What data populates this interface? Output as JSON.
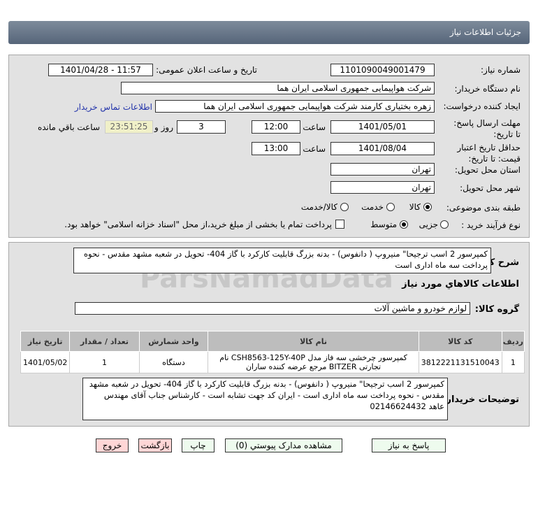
{
  "header": {
    "title": "جزئیات اطلاعات نیاز"
  },
  "watermark": "ParsNamadData",
  "form": {
    "need_number_label": "شماره نیاز:",
    "need_number": "1101090049001479",
    "announce_label": "تاریخ و ساعت اعلان عمومی:",
    "announce_value": "1401/04/28 - 11:57",
    "buyer_label": "نام دستگاه خریدار:",
    "buyer_value": "شرکت هواپیمایی جمهوری اسلامی ایران هما",
    "creator_label": "ایجاد کننده درخواست:",
    "creator_value": "زهره بختیاری کارمند شرکت هواپیمایی جمهوری اسلامی ایران هما",
    "contact_link": "اطلاعات تماس خریدار",
    "deadline_label": "مهلت ارسال پاسخ: تا تاریخ:",
    "deadline_date": "1401/05/01",
    "time_label": "ساعت",
    "deadline_time": "12:00",
    "days": "3",
    "days_label": "روز و",
    "remaining": "23:51:25",
    "remaining_label": "ساعت باقي مانده",
    "validity_label": "حداقل تاریخ اعتبار قیمت: تا تاریخ:",
    "validity_date": "1401/08/04",
    "validity_time": "13:00",
    "province_label": "استان محل تحویل:",
    "province": "تهران",
    "city_label": "شهر محل تحویل:",
    "city": "تهران",
    "category_label": "طبقه بندی موضوعی:",
    "category_options": [
      "كالا",
      "خدمت",
      "كالا/خدمت"
    ],
    "category_selected": "كالا",
    "process_label": "نوع فرآیند خرید :",
    "process_options": [
      "جزیی",
      "متوسط"
    ],
    "process_selected": "متوسط",
    "payment_checkbox": "پرداخت تمام یا بخشی از مبلغ خرید،از محل \"اسناد خزانه اسلامی\" خواهد بود.",
    "payment_checked": false
  },
  "details": {
    "summary_label": "شرح کلي نياز:",
    "summary": "کمپرسور  2  اسب ترجیحا\" منیروپ ( دانفوس) - بدنه بزرگ قابلیت کارکرد با گاز 404- تحویل در شعبه مشهد مقدس - نحوه پرداخت سه ماه اداری است",
    "goods_title": "اطلاعات كالاهاي مورد نياز",
    "group_label": "گروه کالا:",
    "group": "لوازم خودرو و ماشین آلات",
    "table": {
      "headers": [
        "ردیف",
        "کد کالا",
        "نام کالا",
        "واحد شمارش",
        "تعداد / مقدار",
        "تاریخ نیاز"
      ],
      "rows": [
        [
          "1",
          "3812221131510043",
          "کمپرسور چرخشی سه فاز مدل CSH8563-125Y-40P نام تجارتی BITZER مرجع عرضه کننده ساران",
          "دستگاه",
          "1",
          "1401/05/02"
        ]
      ]
    },
    "buyer_notes_label": "توضیحات خریدار:",
    "buyer_notes": "کمپرسور  2  اسب ترجیحا\" منیروپ ( دانفوس) - بدنه بزرگ قابلیت کارکرد با گاز 404- تحویل در شعبه مشهد مقدس - نحوه پرداخت سه ماه اداری است -  ایران کد جهت تشابه است - کارشناس جناب آقای مهندس عاهد 02146624432"
  },
  "buttons": {
    "reply": "پاسخ به نیاز",
    "attachments": "مشاهده مدارک پیوستي (0)",
    "print": "چاپ",
    "back": "بازگشت",
    "exit": "خروج"
  }
}
